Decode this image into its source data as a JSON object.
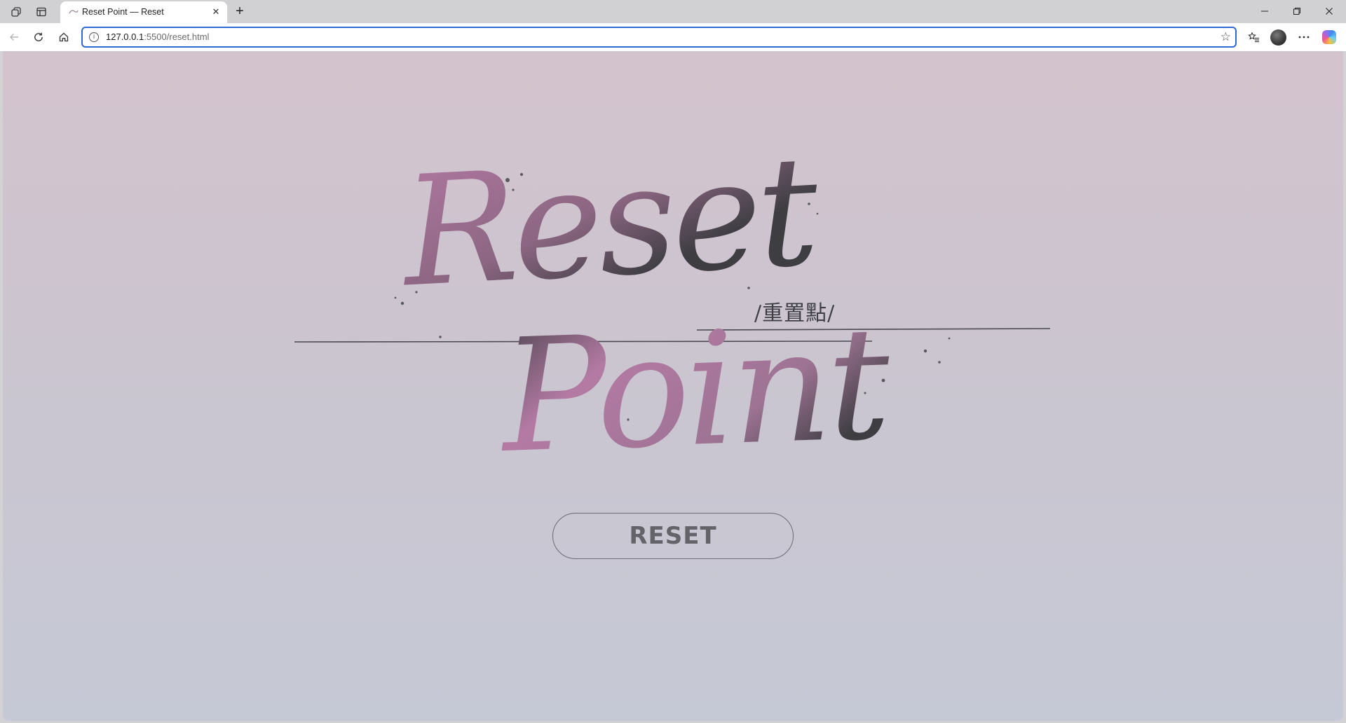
{
  "browser": {
    "tab": {
      "title": "Reset Point — Reset"
    },
    "address": {
      "host": "127.0.0.1",
      "path": ":5500/reset.html"
    },
    "icons": {
      "workspaces": "workspaces-icon",
      "tab_actions": "tab-actions-icon",
      "close": "close-icon",
      "new_tab": "plus-icon",
      "back": "back-arrow-icon",
      "refresh": "refresh-icon",
      "home": "home-icon",
      "info": "info-icon",
      "favorite": "star-icon",
      "favorites": "favorites-icon",
      "more": "more-icon",
      "copilot": "copilot-icon"
    }
  },
  "page": {
    "logo": {
      "line1": "Reset",
      "line2": "Point",
      "subtitle": "/重置點/",
      "colors": {
        "ink": "#3d3d42",
        "accent": "#b47aa4"
      }
    },
    "reset_button": {
      "label": "RESET"
    }
  }
}
